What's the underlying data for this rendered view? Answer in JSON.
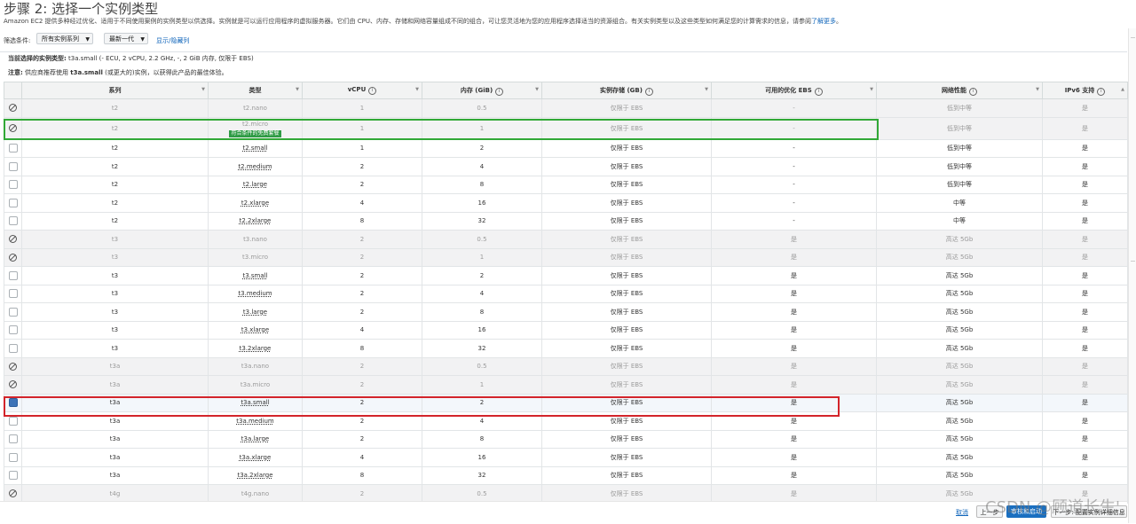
{
  "header": {
    "title": "步骤 2: 选择一个实例类型",
    "description": "Amazon EC2 提供多种经过优化、适用于不同使用案例的实例类型以供选择。实例就是可以运行应用程序的虚拟服务器。它们由 CPU、内存、存储和网络容量组成不同的组合，可让您灵活地为您的应用程序选择适当的资源组合。有关实例类型以及这些类型如何满足您的计算需求的信息，请参阅",
    "learn_more": "了解更多",
    "desc_tail": "。"
  },
  "filter": {
    "label": "筛选条件:",
    "family_select": "所有实例系列",
    "generation_select": "最新一代",
    "toggle_columns": "显示/隐藏列"
  },
  "selection_info": {
    "current_label": "当前选择的实例类型:",
    "current_value": "t3a.small (- ECU, 2 vCPU, 2.2 GHz, -, 2 GiB 内存, 仅限于 EBS)",
    "note_label": "注意:",
    "note_prefix": "供应商推荐使用",
    "note_type": "t3a.small",
    "note_suffix": "(或更大的)实例，以获得此产品的最佳体验。"
  },
  "table": {
    "columns": [
      "系列",
      "类型",
      "vCPU",
      "内存 (GiB)",
      "实例存储 (GB)",
      "可用的优化 EBS",
      "网络性能",
      "IPv6 支持"
    ],
    "free_tier_badge": "符合条件的免费套餐",
    "rows": [
      {
        "family": "t2",
        "type": "t2.nano",
        "vcpu": "1",
        "mem": "0.5",
        "storage": "仅限于 EBS",
        "ebs": "-",
        "net": "低到中等",
        "ipv6": "是",
        "state": "disabled"
      },
      {
        "family": "t2",
        "type": "t2.micro",
        "vcpu": "1",
        "mem": "1",
        "storage": "仅限于 EBS",
        "ebs": "-",
        "net": "低到中等",
        "ipv6": "是",
        "state": "disabled",
        "free": true
      },
      {
        "family": "t2",
        "type": "t2.small",
        "vcpu": "1",
        "mem": "2",
        "storage": "仅限于 EBS",
        "ebs": "-",
        "net": "低到中等",
        "ipv6": "是",
        "state": "normal"
      },
      {
        "family": "t2",
        "type": "t2.medium",
        "vcpu": "2",
        "mem": "4",
        "storage": "仅限于 EBS",
        "ebs": "-",
        "net": "低到中等",
        "ipv6": "是",
        "state": "normal"
      },
      {
        "family": "t2",
        "type": "t2.large",
        "vcpu": "2",
        "mem": "8",
        "storage": "仅限于 EBS",
        "ebs": "-",
        "net": "低到中等",
        "ipv6": "是",
        "state": "normal"
      },
      {
        "family": "t2",
        "type": "t2.xlarge",
        "vcpu": "4",
        "mem": "16",
        "storage": "仅限于 EBS",
        "ebs": "-",
        "net": "中等",
        "ipv6": "是",
        "state": "normal"
      },
      {
        "family": "t2",
        "type": "t2.2xlarge",
        "vcpu": "8",
        "mem": "32",
        "storage": "仅限于 EBS",
        "ebs": "-",
        "net": "中等",
        "ipv6": "是",
        "state": "normal"
      },
      {
        "family": "t3",
        "type": "t3.nano",
        "vcpu": "2",
        "mem": "0.5",
        "storage": "仅限于 EBS",
        "ebs": "是",
        "net": "高达 5Gb",
        "ipv6": "是",
        "state": "disabled"
      },
      {
        "family": "t3",
        "type": "t3.micro",
        "vcpu": "2",
        "mem": "1",
        "storage": "仅限于 EBS",
        "ebs": "是",
        "net": "高达 5Gb",
        "ipv6": "是",
        "state": "disabled"
      },
      {
        "family": "t3",
        "type": "t3.small",
        "vcpu": "2",
        "mem": "2",
        "storage": "仅限于 EBS",
        "ebs": "是",
        "net": "高达 5Gb",
        "ipv6": "是",
        "state": "normal"
      },
      {
        "family": "t3",
        "type": "t3.medium",
        "vcpu": "2",
        "mem": "4",
        "storage": "仅限于 EBS",
        "ebs": "是",
        "net": "高达 5Gb",
        "ipv6": "是",
        "state": "normal"
      },
      {
        "family": "t3",
        "type": "t3.large",
        "vcpu": "2",
        "mem": "8",
        "storage": "仅限于 EBS",
        "ebs": "是",
        "net": "高达 5Gb",
        "ipv6": "是",
        "state": "normal"
      },
      {
        "family": "t3",
        "type": "t3.xlarge",
        "vcpu": "4",
        "mem": "16",
        "storage": "仅限于 EBS",
        "ebs": "是",
        "net": "高达 5Gb",
        "ipv6": "是",
        "state": "normal"
      },
      {
        "family": "t3",
        "type": "t3.2xlarge",
        "vcpu": "8",
        "mem": "32",
        "storage": "仅限于 EBS",
        "ebs": "是",
        "net": "高达 5Gb",
        "ipv6": "是",
        "state": "normal"
      },
      {
        "family": "t3a",
        "type": "t3a.nano",
        "vcpu": "2",
        "mem": "0.5",
        "storage": "仅限于 EBS",
        "ebs": "是",
        "net": "高达 5Gb",
        "ipv6": "是",
        "state": "disabled"
      },
      {
        "family": "t3a",
        "type": "t3a.micro",
        "vcpu": "2",
        "mem": "1",
        "storage": "仅限于 EBS",
        "ebs": "是",
        "net": "高达 5Gb",
        "ipv6": "是",
        "state": "disabled"
      },
      {
        "family": "t3a",
        "type": "t3a.small",
        "vcpu": "2",
        "mem": "2",
        "storage": "仅限于 EBS",
        "ebs": "是",
        "net": "高达 5Gb",
        "ipv6": "是",
        "state": "selected"
      },
      {
        "family": "t3a",
        "type": "t3a.medium",
        "vcpu": "2",
        "mem": "4",
        "storage": "仅限于 EBS",
        "ebs": "是",
        "net": "高达 5Gb",
        "ipv6": "是",
        "state": "normal"
      },
      {
        "family": "t3a",
        "type": "t3a.large",
        "vcpu": "2",
        "mem": "8",
        "storage": "仅限于 EBS",
        "ebs": "是",
        "net": "高达 5Gb",
        "ipv6": "是",
        "state": "normal"
      },
      {
        "family": "t3a",
        "type": "t3a.xlarge",
        "vcpu": "4",
        "mem": "16",
        "storage": "仅限于 EBS",
        "ebs": "是",
        "net": "高达 5Gb",
        "ipv6": "是",
        "state": "normal"
      },
      {
        "family": "t3a",
        "type": "t3a.2xlarge",
        "vcpu": "8",
        "mem": "32",
        "storage": "仅限于 EBS",
        "ebs": "是",
        "net": "高达 5Gb",
        "ipv6": "是",
        "state": "normal"
      },
      {
        "family": "t4g",
        "type": "t4g.nano",
        "vcpu": "2",
        "mem": "0.5",
        "storage": "仅限于 EBS",
        "ebs": "是",
        "net": "高达 5Gb",
        "ipv6": "是",
        "state": "disabled"
      }
    ]
  },
  "footer": {
    "cancel": "取消",
    "previous": "上一步",
    "review_launch": "审核和启动",
    "next": "下一步: 配置实例详细信息"
  },
  "watermark": "CSDN @顾道长生'",
  "colors": {
    "highlight_green": "#31a836",
    "highlight_red": "#d3242a",
    "primary_button": "#1a6fc0",
    "link": "#1166bb"
  }
}
